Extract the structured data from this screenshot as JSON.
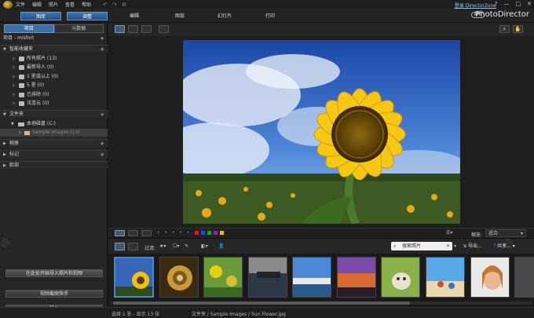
{
  "app": {
    "brand": "PhotoDirector",
    "login_label": "登录 DirectorZone",
    "app_badge": "APP"
  },
  "menu": [
    "文件",
    "编辑",
    "照片",
    "查看",
    "帮助"
  ],
  "window_buttons": [
    "?",
    "—",
    "□",
    "✕"
  ],
  "mode_tabs": {
    "library": "图库",
    "adjust": "调整",
    "edit": "编辑",
    "layers": "图层",
    "slideshow": "幻灯片",
    "print": "打印"
  },
  "left_panel": {
    "tabs": [
      "项目",
      "元数据"
    ],
    "project_label": "项目 - misfort",
    "smart_collections": {
      "title": "智能收藏夹",
      "items": [
        "所有照片 (13)",
        "最新导入 (0)",
        "1 星或以上 (0)",
        "5 星 (0)",
        "已排除 (0)",
        "讯连云 (0)"
      ]
    },
    "folders": {
      "title": "文件夹",
      "drive": "本地磁盘 (C:)",
      "folder": "Sample Images (13)"
    },
    "albums": "相册",
    "tags": "标记",
    "faces": "脸部",
    "buttons": {
      "tip": "在此处开始导入照片和视频",
      "video_assistant": "视频截图快手",
      "import": "导入"
    }
  },
  "filter_bar": {
    "filter_label": "过滤:",
    "search_placeholder": "搜索照片",
    "export_label": "导出...",
    "share_label": "共享..."
  },
  "thumb_bar": {
    "zoom_label": "缩放:",
    "zoom_value": "适合"
  },
  "colors": {
    "accent": "#3b78b8",
    "label_colors": [
      "#d02020",
      "#2050d0",
      "#20a020",
      "#9020c0",
      "#e0c020"
    ]
  },
  "status": {
    "selection": "选择 1 张 - 显示 13 张",
    "path": "文件夹 / Sample Images / Sun Flower.jpg"
  },
  "icons": [
    "undo-icon",
    "redo-icon",
    "settings-icon",
    "search-icon",
    "hand-icon"
  ]
}
